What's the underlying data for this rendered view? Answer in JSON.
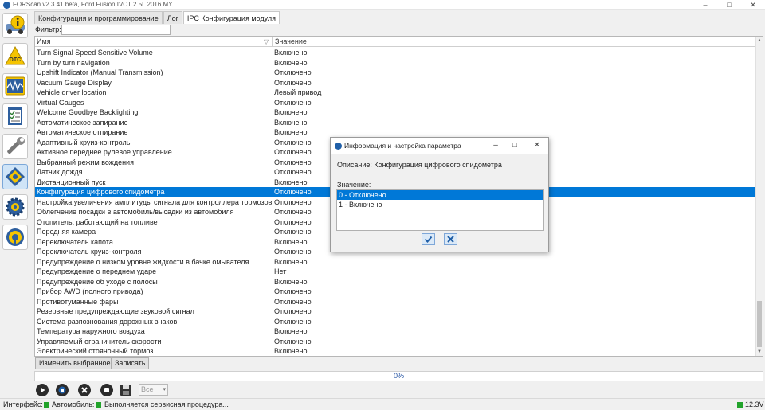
{
  "window": {
    "title": "FORScan v2.3.41 beta, Ford Fusion IVCT 2.5L 2016 MY",
    "min_glyph": "–",
    "max_glyph": "□",
    "close_glyph": "✕"
  },
  "sidebar": {
    "items": [
      {
        "icon": "info-icon"
      },
      {
        "icon": "dtc-icon",
        "text": "DTC"
      },
      {
        "icon": "oscilloscope-icon"
      },
      {
        "icon": "checklist-icon"
      },
      {
        "icon": "wrench-icon"
      },
      {
        "icon": "module-config-icon",
        "active": true
      },
      {
        "icon": "gear-icon"
      },
      {
        "icon": "steering-wheel-icon"
      }
    ]
  },
  "tabs": [
    {
      "label": "Конфигурация и программирование"
    },
    {
      "label": "Лог"
    },
    {
      "label": "IPC Конфигурация модуля",
      "active": true
    }
  ],
  "filter": {
    "label": "Фильтр:",
    "value": ""
  },
  "grid": {
    "headers": {
      "name": "Имя",
      "value": "Значение"
    },
    "rows": [
      {
        "name": "Turn Signal Speed Sensitive Volume",
        "value": "Включено"
      },
      {
        "name": "Turn by turn navigation",
        "value": "Включено"
      },
      {
        "name": "Upshift Indicator (Manual Transmission)",
        "value": "Отключено"
      },
      {
        "name": "Vacuum Gauge Display",
        "value": "Отключено"
      },
      {
        "name": "Vehicle driver location",
        "value": "Левый привод"
      },
      {
        "name": "Virtual Gauges",
        "value": "Отключено"
      },
      {
        "name": "Welcome Goodbye Backlighting",
        "value": "Включено"
      },
      {
        "name": "Автоматическое запирание",
        "value": "Включено"
      },
      {
        "name": "Автоматическое отпирание",
        "value": "Включено"
      },
      {
        "name": "Адаптивный круиз-контроль",
        "value": "Отключено"
      },
      {
        "name": "Активное переднее рулевое управление",
        "value": "Отключено"
      },
      {
        "name": "Выбранный режим вождения",
        "value": "Отключено"
      },
      {
        "name": "Датчик дождя",
        "value": "Отключено"
      },
      {
        "name": "Дистанционный пуск",
        "value": "Включено"
      },
      {
        "name": "Конфигурация цифрового спидометра",
        "value": "Отключено",
        "selected": true
      },
      {
        "name": "Настройка увеличения амплитуды сигнала для контроллера тормозов пр...",
        "value": "Отключено"
      },
      {
        "name": "Облегчение посадки в автомобиль/высадки из автомобиля",
        "value": "Отключено"
      },
      {
        "name": "Отопитель, работающий на топливе",
        "value": "Отключено"
      },
      {
        "name": "Передняя камера",
        "value": "Отключено"
      },
      {
        "name": "Переключатель капота",
        "value": "Включено"
      },
      {
        "name": "Переключатель круиз-контроля",
        "value": "Отключено"
      },
      {
        "name": "Предупреждение о низком уровне жидкости в бачке омывателя",
        "value": "Включено"
      },
      {
        "name": "Предупреждение о переднем ударе",
        "value": "Нет"
      },
      {
        "name": "Предупреждение об уходе с полосы",
        "value": "Включено"
      },
      {
        "name": "Прибор AWD (полного привода)",
        "value": "Отключено"
      },
      {
        "name": "Противотуманные фары",
        "value": "Отключено"
      },
      {
        "name": "Резервные предупреждающие звуковой сигнал",
        "value": "Отключено"
      },
      {
        "name": "Система разпознования дорожных знаков",
        "value": "Отключено"
      },
      {
        "name": "Температура наружного воздуха",
        "value": "Включено"
      },
      {
        "name": "Управляемый ограничитель скорости",
        "value": "Отключено"
      },
      {
        "name": "Электрический стояночный тормоз",
        "value": "Включено"
      }
    ]
  },
  "buttons": {
    "change_selected": "Изменить выбранное",
    "write": "Записать"
  },
  "progress": {
    "percent": 0,
    "label": "0%"
  },
  "toolbar": {
    "filter_select": "Все"
  },
  "status": {
    "interface_label": "Интерфейс:",
    "vehicle_label": "Автомобиль:",
    "message": "Выполняется сервисная процедура...",
    "voltage": "12.3V",
    "ok_color": "#22a32b"
  },
  "dialog": {
    "title": "Информация и настройка параметра",
    "description": "Описание: Конфигурация цифрового спидометра",
    "value_label": "Значение:",
    "options": [
      {
        "label": "0 - Отключено",
        "selected": true
      },
      {
        "label": "1 - Включено"
      }
    ],
    "accent": "#0078d7"
  }
}
